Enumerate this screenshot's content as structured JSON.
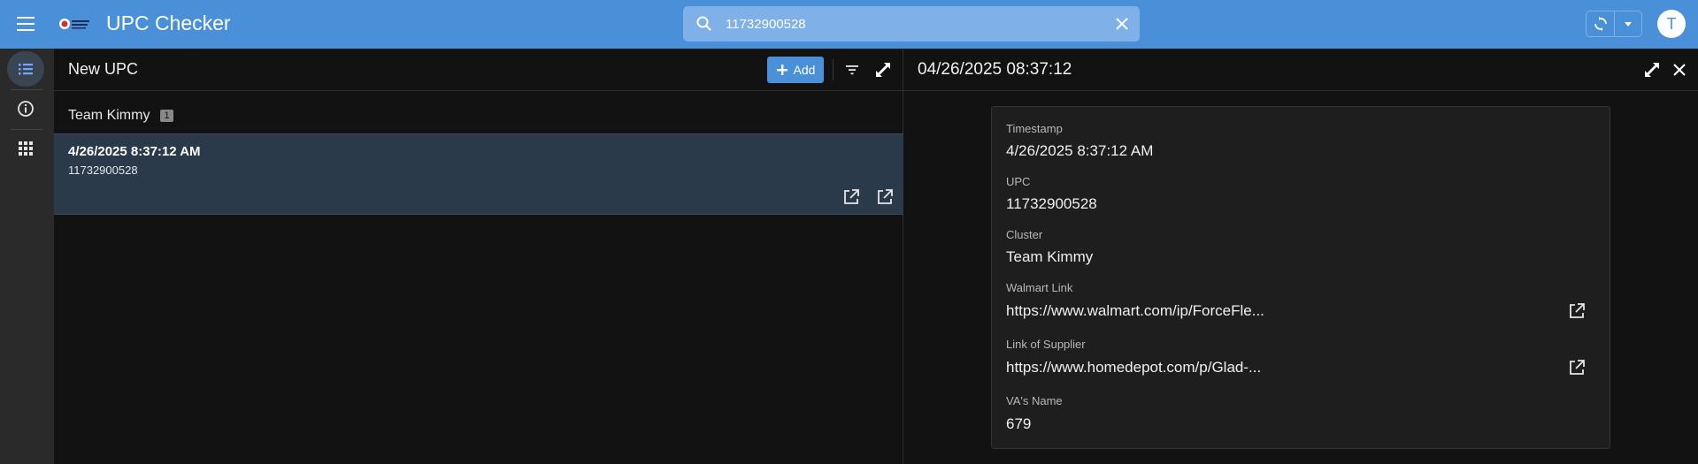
{
  "app": {
    "title": "UPC Checker",
    "accent_color": "#4a90d9"
  },
  "search": {
    "value": "11732900528"
  },
  "user": {
    "avatar_initial": "T"
  },
  "nav": {
    "items": [
      {
        "icon": "list-icon",
        "active": true
      },
      {
        "icon": "info-icon",
        "active": false
      },
      {
        "icon": "apps-grid-icon",
        "active": false
      }
    ]
  },
  "list": {
    "title": "New UPC",
    "add_label": "Add",
    "group": {
      "name": "Team Kimmy",
      "count": "1"
    },
    "items": [
      {
        "title": "4/26/2025 8:37:12 AM",
        "subtitle": "11732900528"
      }
    ]
  },
  "detail": {
    "title": "04/26/2025 08:37:12",
    "fields": [
      {
        "label": "Timestamp",
        "value": "4/26/2025 8:37:12 AM"
      },
      {
        "label": "UPC",
        "value": "11732900528"
      },
      {
        "label": "Cluster",
        "value": "Team Kimmy"
      },
      {
        "label": "Walmart Link",
        "value": "https://www.walmart.com/ip/ForceFle..."
      },
      {
        "label": "Link of Supplier",
        "value": "https://www.homedepot.com/p/Glad-..."
      },
      {
        "label": "VA's Name",
        "value": "679"
      }
    ]
  }
}
